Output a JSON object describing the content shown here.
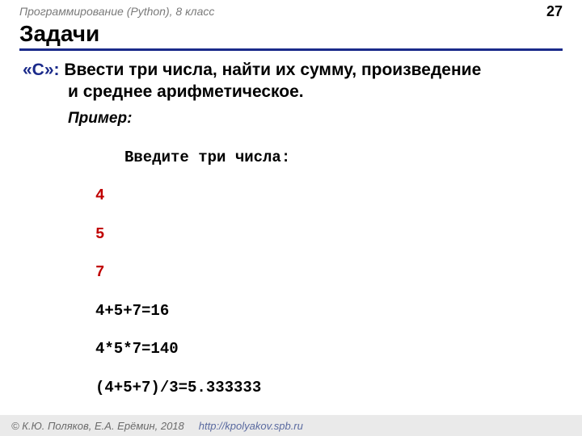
{
  "header": {
    "course_title": "Программирование (Python), 8 класс",
    "page_number": "27"
  },
  "title": "Задачи",
  "task": {
    "marker": "«C»:",
    "text_line1": " Ввести три числа, найти их сумму, произведение",
    "text_line2": "и среднее арифметическое."
  },
  "example": {
    "label": "Пример:",
    "prompt": "Введите три числа:",
    "inputs": [
      "4",
      "5",
      "7"
    ],
    "outputs": [
      "4+5+7=16",
      "4*5*7=140",
      "(4+5+7)/3=5.333333"
    ]
  },
  "footer": {
    "copyright": "К.Ю. Поляков, Е.А. Ерёмин, 2018",
    "url": "http://kpolyakov.spb.ru"
  }
}
